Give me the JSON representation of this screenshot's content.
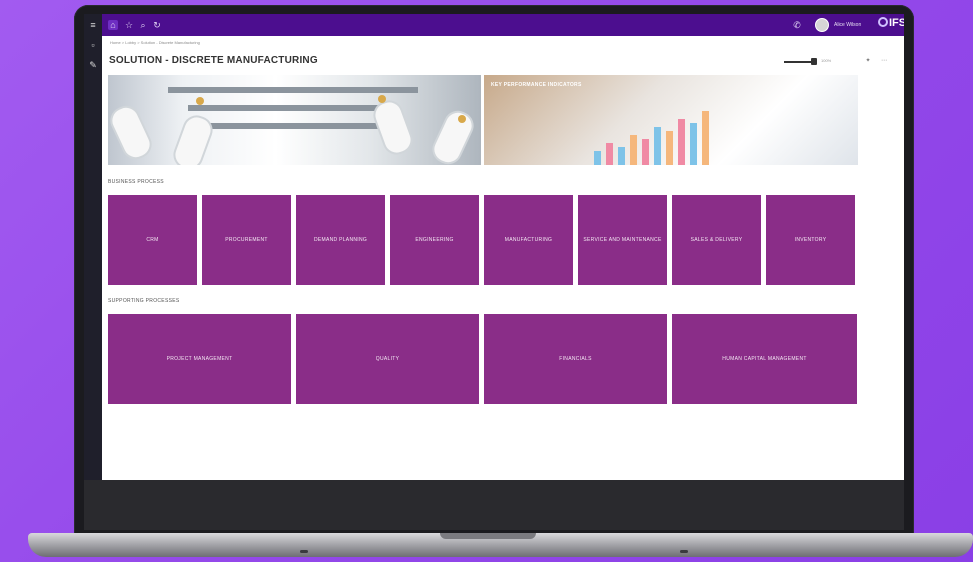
{
  "app": {
    "logo": "IFS",
    "user_name": "Alice Wilson"
  },
  "breadcrumb": "Home > Lobby > Solution - Discrete Manufacturing",
  "page": {
    "title": "SOLUTION - DISCRETE MANUFACTURING",
    "zoom_label": "100%"
  },
  "banners": {
    "kpi_label": "KEY PERFORMANCE INDICATORS"
  },
  "sections": {
    "business_label": "BUSINESS PROCESS",
    "supporting_label": "SUPPORTING PROCESSES"
  },
  "business_tiles": [
    {
      "label": "CRM"
    },
    {
      "label": "PROCUREMENT"
    },
    {
      "label": "DEMAND PLANNING"
    },
    {
      "label": "ENGINEERING"
    },
    {
      "label": "MANUFACTURING"
    },
    {
      "label": "SERVICE AND MAINTENANCE"
    },
    {
      "label": "SALES & DELIVERY"
    },
    {
      "label": "INVENTORY"
    }
  ],
  "supporting_tiles": [
    {
      "label": "PROJECT MANAGEMENT"
    },
    {
      "label": "QUALITY"
    },
    {
      "label": "FINANCIALS"
    },
    {
      "label": "HUMAN CAPITAL MANAGEMENT"
    }
  ],
  "colors": {
    "tile": "#8a2d88",
    "topbar": "#4c0e8f",
    "background": "#9449ea"
  }
}
